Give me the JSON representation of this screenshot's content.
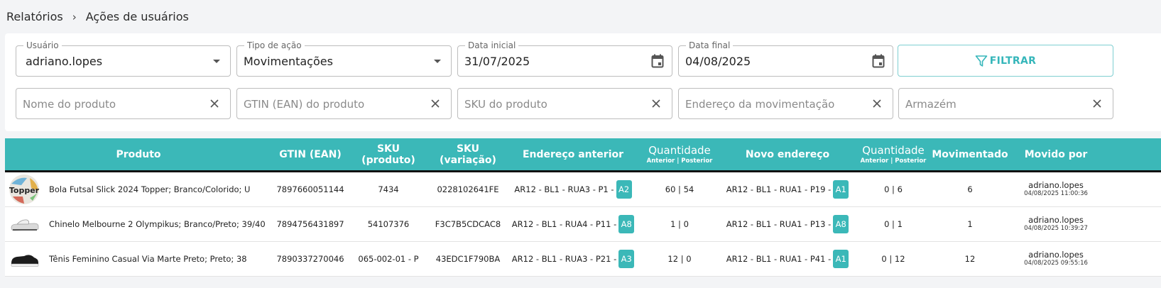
{
  "breadcrumb": {
    "parent": "Relatórios",
    "separator": "›",
    "current": "Ações de usuários"
  },
  "filters": {
    "usuario": {
      "label": "Usuário",
      "value": "adriano.lopes"
    },
    "tipo_acao": {
      "label": "Tipo de ação",
      "value": "Movimentações"
    },
    "data_inicial": {
      "label": "Data inicial",
      "value": "31/07/2025"
    },
    "data_final": {
      "label": "Data final",
      "value": "04/08/2025"
    },
    "filter_button": "FILTRAR",
    "nome_produto": {
      "placeholder": "Nome do produto"
    },
    "gtin": {
      "placeholder": "GTIN (EAN) do produto"
    },
    "sku": {
      "placeholder": "SKU do produto"
    },
    "endereco": {
      "placeholder": "Endereço da movimentação"
    },
    "armazem": {
      "placeholder": "Armazém"
    }
  },
  "table": {
    "headers": {
      "produto": "Produto",
      "gtin": "GTIN (EAN)",
      "sku_produto": "SKU (produto)",
      "sku_variacao": "SKU (variação)",
      "endereco_anterior": "Endereço anterior",
      "quantidade": "Quantidade",
      "quantidade_sub": "Anterior | Posterior",
      "novo_endereco": "Novo endereço",
      "quantidade2": "Quantidade",
      "quantidade2_sub": "Anterior | Posterior",
      "movimentado": "Movimentado",
      "movido_por": "Movido por"
    },
    "rows": [
      {
        "produto": "Bola Futsal Slick 2024 Topper; Branco/Colorido; U",
        "thumb_text": "Topper",
        "gtin": "7897660051144",
        "sku_produto": "7434",
        "sku_variacao": "0228102641FE",
        "endereco_anterior": "AR12 - BL1 - RUA3 - P1 -",
        "armazem_anterior": "A2",
        "quantidade_anterior": "60 | 54",
        "novo_endereco": "AR12 - BL1 - RUA1 - P19 -",
        "armazem_novo": "A1",
        "quantidade_nova": "0 | 6",
        "movimentado": "6",
        "movido_por": "adriano.lopes",
        "data": "04/08/2025 11:00:36"
      },
      {
        "produto": "Chinelo Melbourne 2 Olympikus; Branco/Preto; 39/40",
        "gtin": "7894756431897",
        "sku_produto": "54107376",
        "sku_variacao": "F3C7B5CDCAC8",
        "endereco_anterior": "AR12 - BL1 - RUA4 - P11 -",
        "armazem_anterior": "A8",
        "quantidade_anterior": "1 | 0",
        "novo_endereco": "AR12 - BL1 - RUA1 - P13 -",
        "armazem_novo": "A8",
        "quantidade_nova": "0 | 1",
        "movimentado": "1",
        "movido_por": "adriano.lopes",
        "data": "04/08/2025 10:39:27"
      },
      {
        "produto": "Tênis Feminino Casual Via Marte Preto; Preto; 38",
        "gtin": "7890337270046",
        "sku_produto": "065-002-01 - P",
        "sku_variacao": "43EDC1F790BA",
        "endereco_anterior": "AR12 - BL1 - RUA3 - P21 -",
        "armazem_anterior": "A3",
        "quantidade_anterior": "12 | 0",
        "novo_endereco": "AR12 - BL1 - RUA1 - P41 -",
        "armazem_novo": "A1",
        "quantidade_nova": "0 | 12",
        "movimentado": "12",
        "movido_por": "adriano.lopes",
        "data": "04/08/2025 09:55:16"
      }
    ]
  },
  "colors": {
    "accent": "#3bb8b8",
    "filter_text": "#35b6ba"
  },
  "icons": [
    "chevron-right-icon",
    "caret-down-icon",
    "calendar-icon",
    "funnel-icon",
    "close-icon"
  ]
}
